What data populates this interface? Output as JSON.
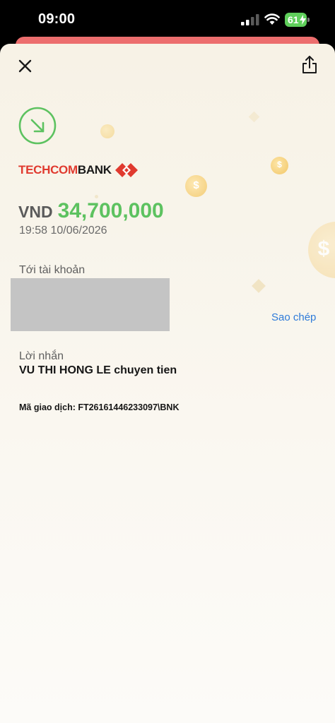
{
  "status_bar": {
    "time": "09:00",
    "battery_level": "61",
    "battery_color": "#5fcf5b"
  },
  "header": {
    "close_icon": "close-icon",
    "share_icon": "share-icon"
  },
  "transaction": {
    "direction_icon": "arrow-down-right-circle-icon",
    "bank_name_red": "TECHCOM",
    "bank_name_dark": "BANK",
    "currency": "VND",
    "amount": "34,700,000",
    "datetime": "19:58 10/06/2026",
    "to_account_label": "Tới tài khoản",
    "copy_label": "Sao chép",
    "message_label": "Lời nhắn",
    "message_value": "VU THI HONG LE chuyen tien",
    "txn_id": "Mã giao dịch: FT26161446233097\\BNK"
  },
  "colors": {
    "accent_green": "#5dc260",
    "brand_red": "#e03a2f",
    "link_blue": "#2f7bd9",
    "banner_red": "#ec6e6e"
  }
}
